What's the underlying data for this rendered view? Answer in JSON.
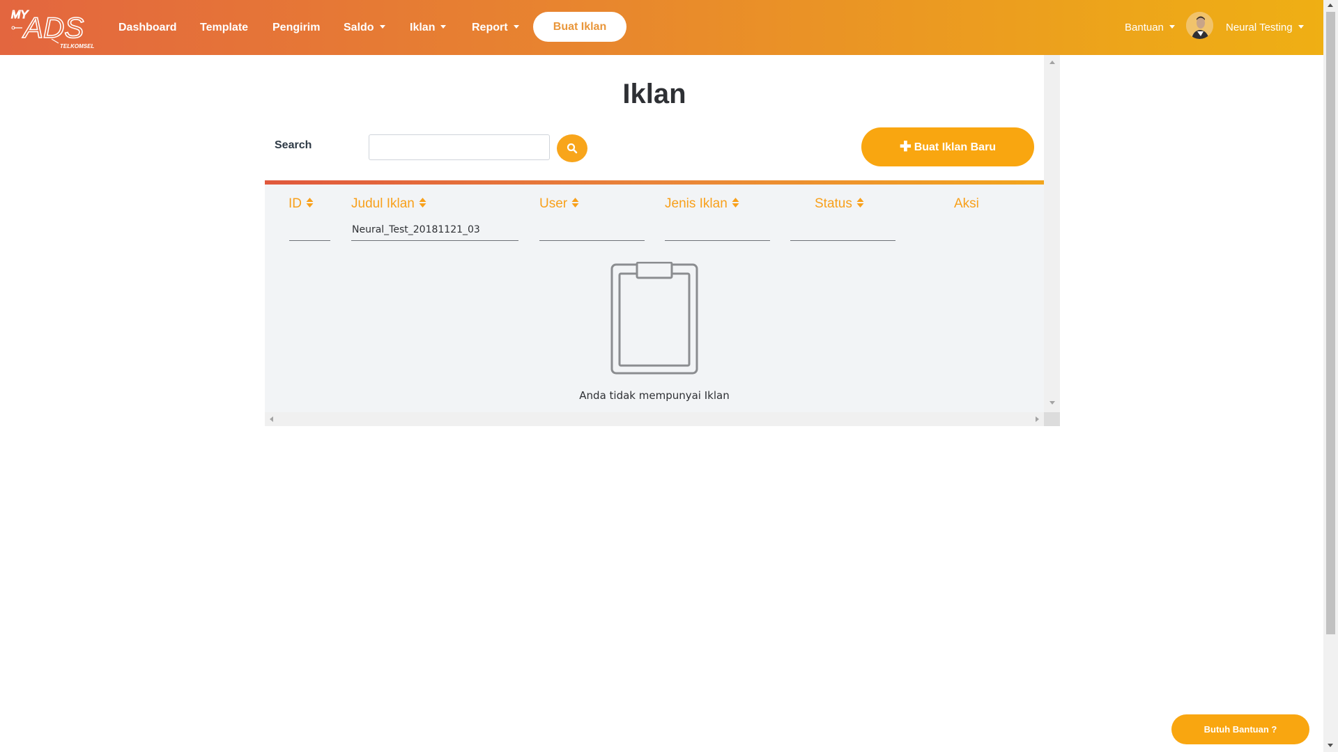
{
  "brand": {
    "logo_top": "MY",
    "logo_main": "ADS",
    "logo_sub": "TELKOMSEL"
  },
  "nav": {
    "items": [
      {
        "label": "Dashboard",
        "dropdown": false
      },
      {
        "label": "Template",
        "dropdown": false
      },
      {
        "label": "Pengirim",
        "dropdown": false
      },
      {
        "label": "Saldo",
        "dropdown": true
      },
      {
        "label": "Iklan",
        "dropdown": true
      },
      {
        "label": "Report",
        "dropdown": true
      }
    ],
    "cta_label": "Buat Iklan",
    "help_label": "Bantuan",
    "user_name": "Neural Testing"
  },
  "page": {
    "title": "Iklan",
    "search_label": "Search",
    "search_value": "",
    "new_button_label": "Buat Iklan Baru"
  },
  "table": {
    "columns": [
      {
        "label": "ID",
        "sortable": true,
        "filter": ""
      },
      {
        "label": "Judul Iklan",
        "sortable": true,
        "filter": "Neural_Test_20181121_03"
      },
      {
        "label": "User",
        "sortable": true,
        "filter": ""
      },
      {
        "label": "Jenis Iklan",
        "sortable": true,
        "filter": ""
      },
      {
        "label": "Status",
        "sortable": true,
        "filter": ""
      },
      {
        "label": "Aksi",
        "sortable": false
      }
    ],
    "empty_message": "Anda tidak mempunyai Iklan"
  },
  "help_widget": {
    "label": "Butuh Bantuan ?"
  },
  "colors": {
    "accent": "#f9a610",
    "header_start": "#e3663f",
    "header_end": "#efaf14",
    "table_bg": "#f2f4f6"
  },
  "icons": {
    "search": "search-icon",
    "plus": "plus-icon",
    "sort": "sort-icon",
    "empty": "clipboard-icon"
  }
}
